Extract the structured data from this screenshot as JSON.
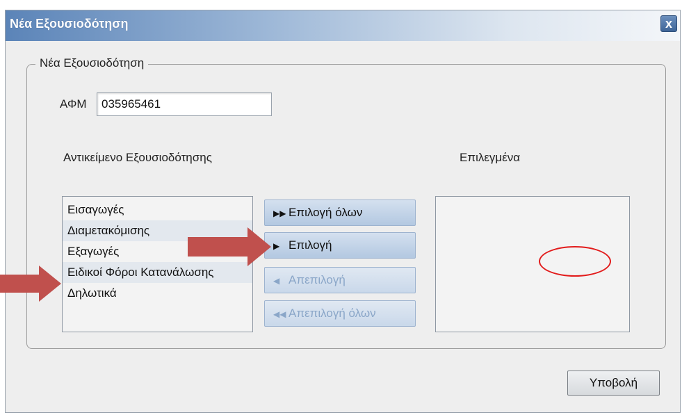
{
  "dialog": {
    "title": "Νέα Εξουσιοδότηση",
    "close_label": "x"
  },
  "group": {
    "legend": "Νέα Εξουσιοδότηση"
  },
  "afm": {
    "label": "ΑΦΜ",
    "value": "035965461"
  },
  "left_list": {
    "header": "Αντικείμενο Εξουσιοδότησης",
    "items": [
      {
        "label": "Εισαγωγές"
      },
      {
        "label": "Διαμετακόμισης"
      },
      {
        "label": "Εξαγωγές"
      },
      {
        "label": "Ειδικοί Φόροι Κατανάλωσης"
      },
      {
        "label": "Δηλωτικά"
      }
    ]
  },
  "right_list": {
    "header": "Επιλεγμένα"
  },
  "buttons": {
    "select_all": {
      "label": "Επιλογή όλων",
      "icon": "fast-forward-icon"
    },
    "select": {
      "label": "Επιλογή",
      "icon": "play-icon"
    },
    "deselect": {
      "label": "Απεπιλογή",
      "icon": "play-left-icon"
    },
    "deselect_all": {
      "label": "Απεπιλογή όλων",
      "icon": "fast-backward-icon"
    },
    "submit": {
      "label": "Υποβολή"
    }
  },
  "annotation_colors": {
    "arrow": "#c0504d",
    "ellipse": "#e21b1b"
  }
}
